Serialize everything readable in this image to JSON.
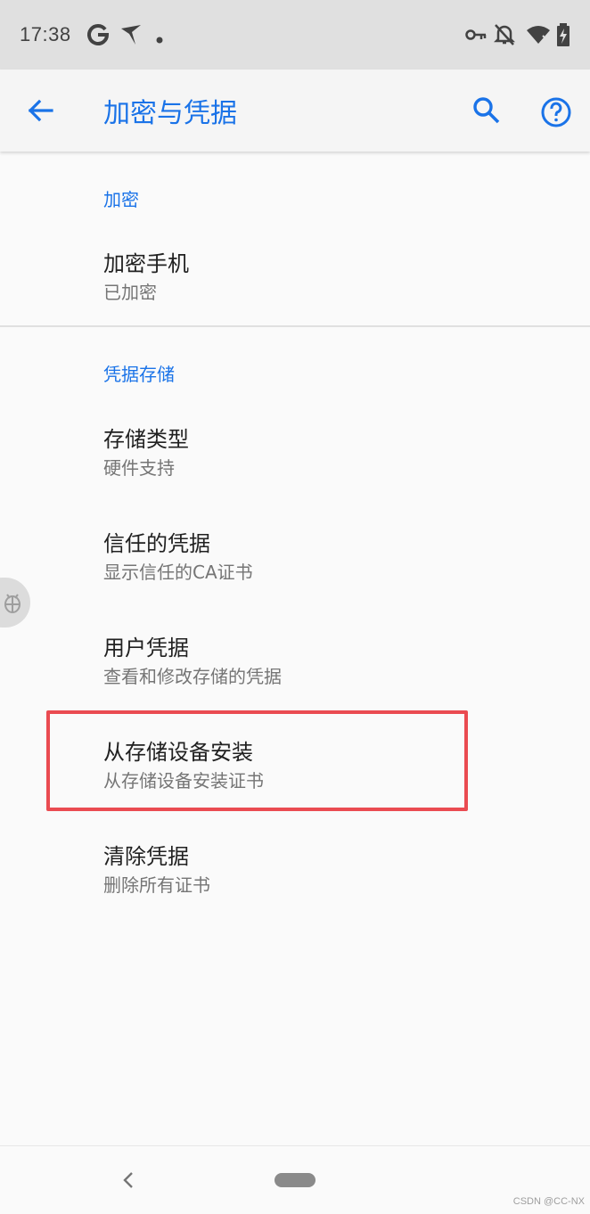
{
  "status_bar": {
    "time": "17:38",
    "icons": [
      "google-g-icon",
      "bird-icon",
      "dot-icon",
      "vpn-key-icon",
      "notifications-off-icon",
      "wifi-icon",
      "battery-charging-icon"
    ]
  },
  "app_bar": {
    "title": "加密与凭据",
    "actions": [
      "back-arrow-icon",
      "search-icon",
      "help-icon"
    ]
  },
  "sections": {
    "encryption": {
      "header": "加密",
      "items": [
        {
          "title": "加密手机",
          "summary": "已加密"
        }
      ]
    },
    "credential_storage": {
      "header": "凭据存储",
      "items": [
        {
          "title": "存储类型",
          "summary": "硬件支持"
        },
        {
          "title": "信任的凭据",
          "summary": "显示信任的CA证书"
        },
        {
          "title": "用户凭据",
          "summary": "查看和修改存储的凭据"
        },
        {
          "title": "从存储设备安装",
          "summary": "从存储设备安装证书"
        },
        {
          "title": "清除凭据",
          "summary": "删除所有证书"
        }
      ]
    }
  },
  "annotation": {
    "highlight_color": "#ea4b51"
  },
  "colors": {
    "accent": "#1a73e8",
    "status_bar_bg": "#e0e0e0",
    "background": "#fafafa"
  },
  "watermark": "CSDN @CC-NX"
}
